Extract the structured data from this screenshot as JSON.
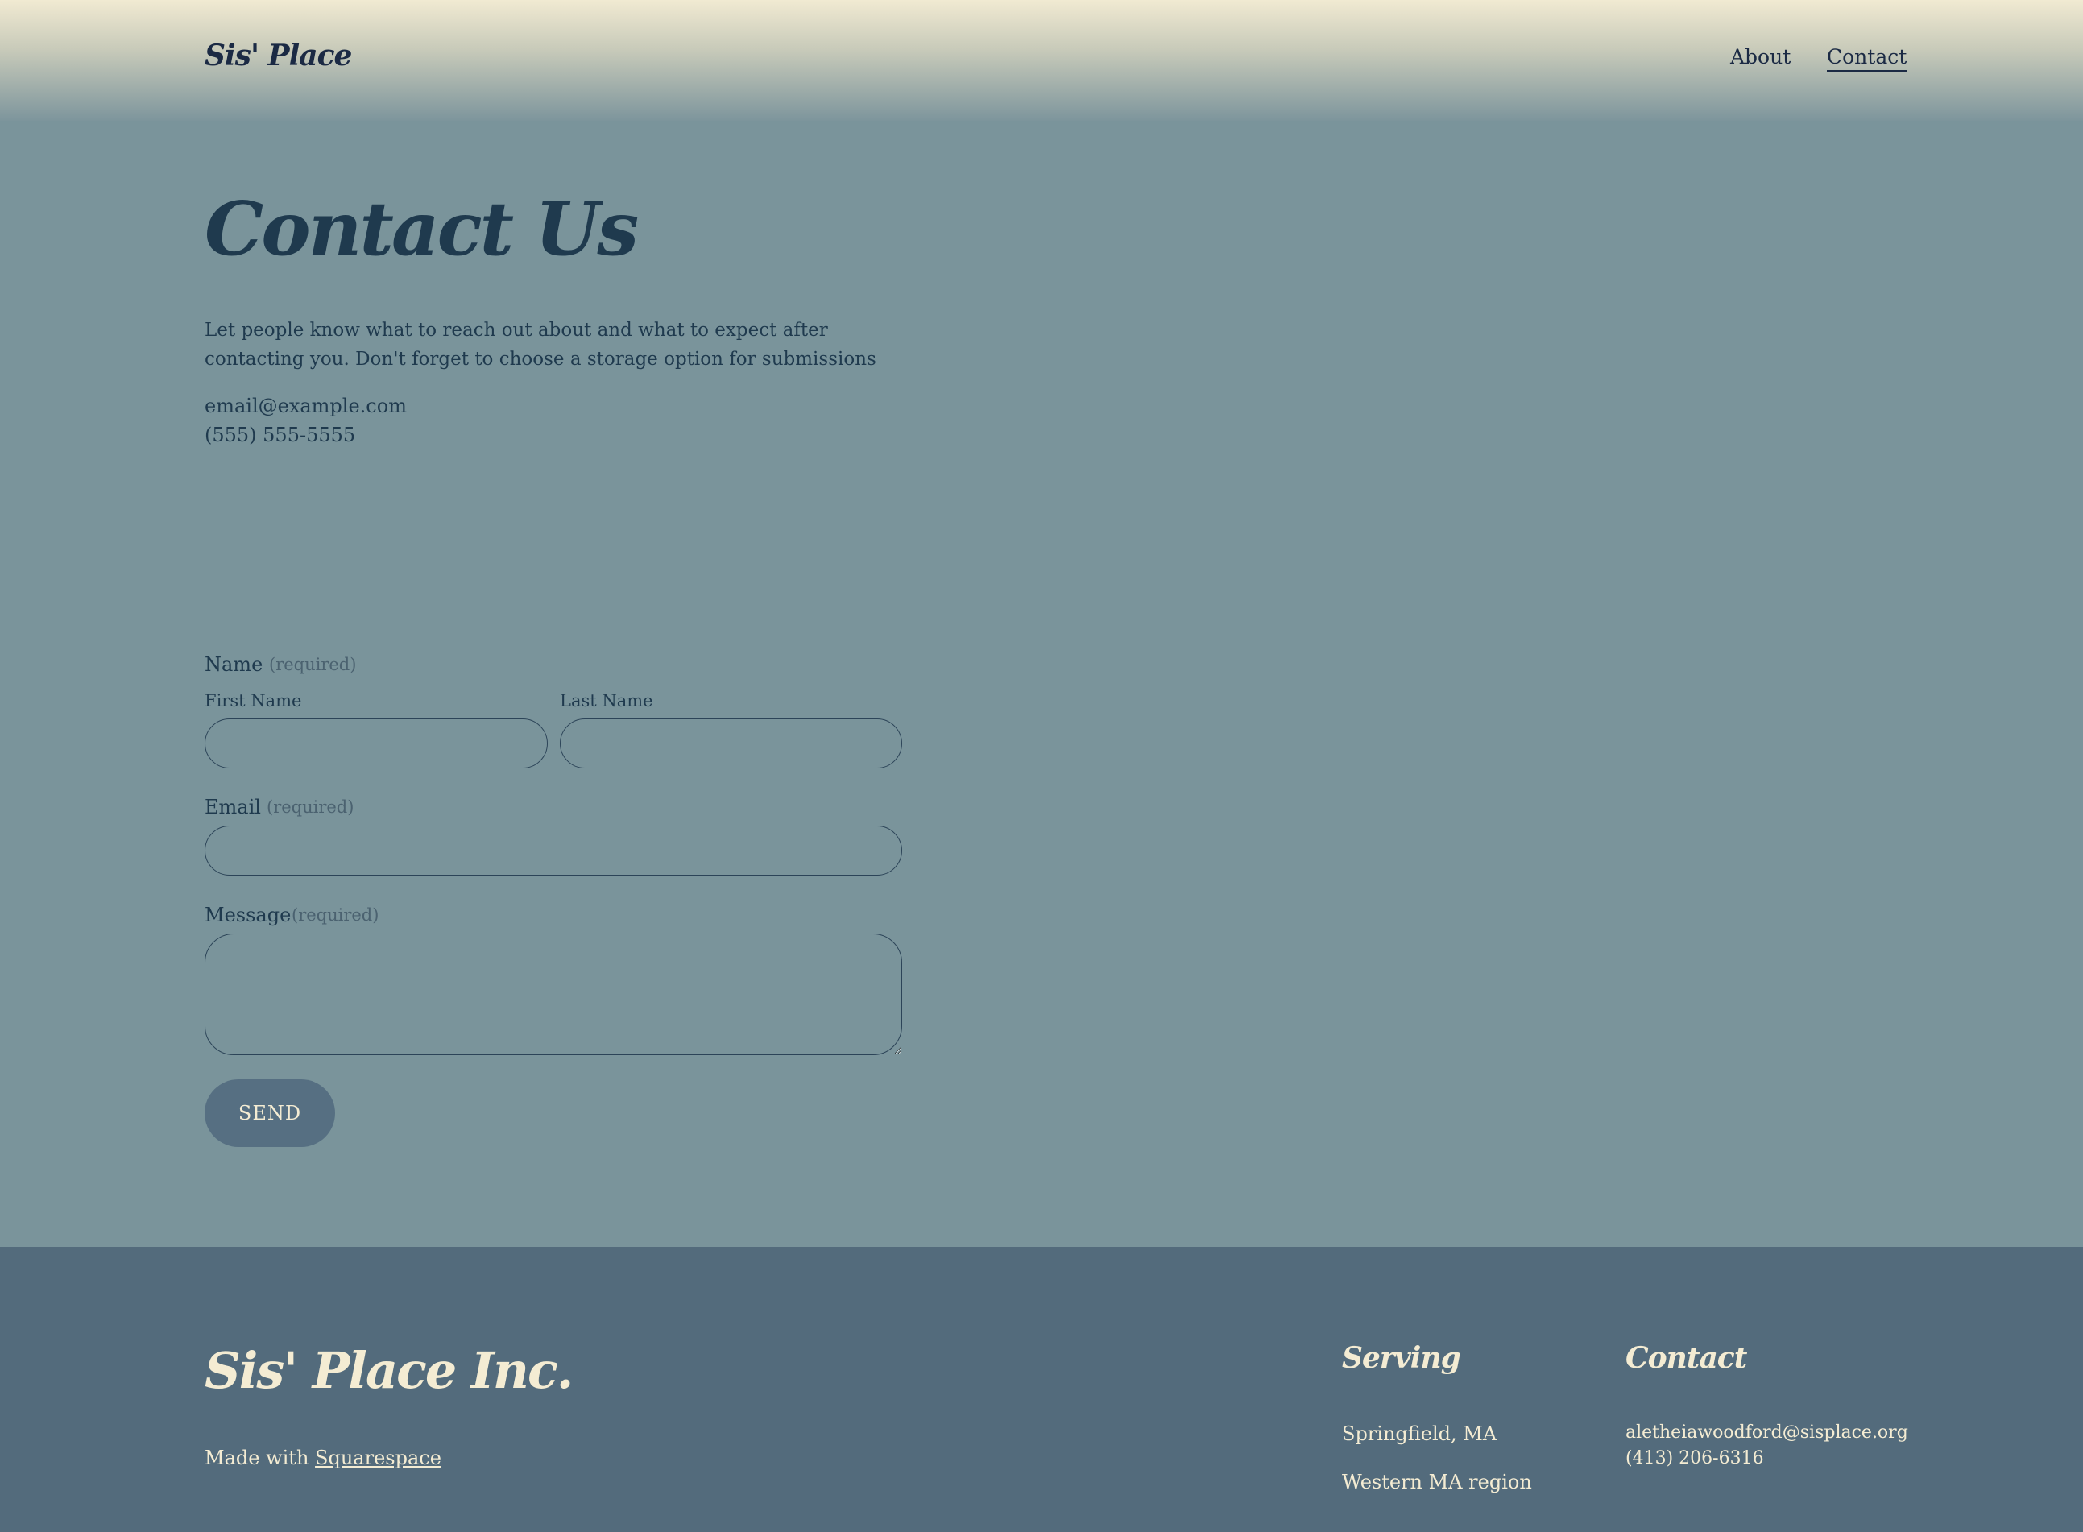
{
  "header": {
    "logo": "Sis' Place",
    "nav": {
      "about": "About",
      "contact": "Contact"
    }
  },
  "main": {
    "title": "Contact Us",
    "intro": "Let people know what to reach out about and what to expect after contacting you. Don't forget to choose a storage option for submissions",
    "email": "email@example.com",
    "phone": "(555) 555-5555"
  },
  "form": {
    "name_label": "Name",
    "required_text": "(required)",
    "first_name_label": "First Name",
    "last_name_label": "Last Name",
    "first_name_value": "",
    "last_name_value": "",
    "email_label": "Email",
    "email_value": "",
    "message_label": "Message",
    "message_value": "",
    "send_label": "SEND"
  },
  "footer": {
    "brand": "Sis' Place Inc.",
    "made_with": "Made with",
    "squarespace": "Squarespace",
    "serving_heading": "Serving",
    "serving_items": [
      "Springfield, MA",
      "Western MA region"
    ],
    "contact_heading": "Contact",
    "contact_email": "aletheiawoodford@sisplace.org",
    "contact_phone": "(413) 206-6316"
  },
  "colors": {
    "page_bg": "#7a949b",
    "footer_bg": "#536b7c",
    "button_bg": "#566f82",
    "cream": "#f4ecd3",
    "navy": "#1b2a44"
  }
}
